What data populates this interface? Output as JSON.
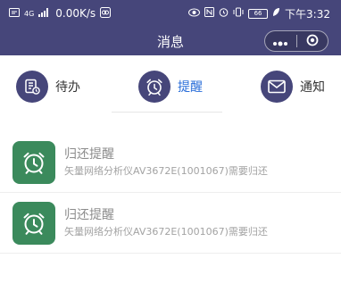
{
  "status_bar": {
    "network": "4G",
    "speed": "0.00K/s",
    "battery": "66",
    "time": "下午3:32"
  },
  "navbar": {
    "title": "消息"
  },
  "tabs": [
    {
      "label": "待办",
      "active": false
    },
    {
      "label": "提醒",
      "active": true
    },
    {
      "label": "通知",
      "active": false
    }
  ],
  "messages": [
    {
      "title": "归还提醒",
      "desc": "矢量网络分析仪AV3672E(1001067)需要归还"
    },
    {
      "title": "归还提醒",
      "desc": "矢量网络分析仪AV3672E(1001067)需要归还"
    }
  ],
  "colors": {
    "header_bg": "#46467a",
    "active_tab": "#2a6ed9",
    "icon_bg": "#3b8a5c"
  }
}
